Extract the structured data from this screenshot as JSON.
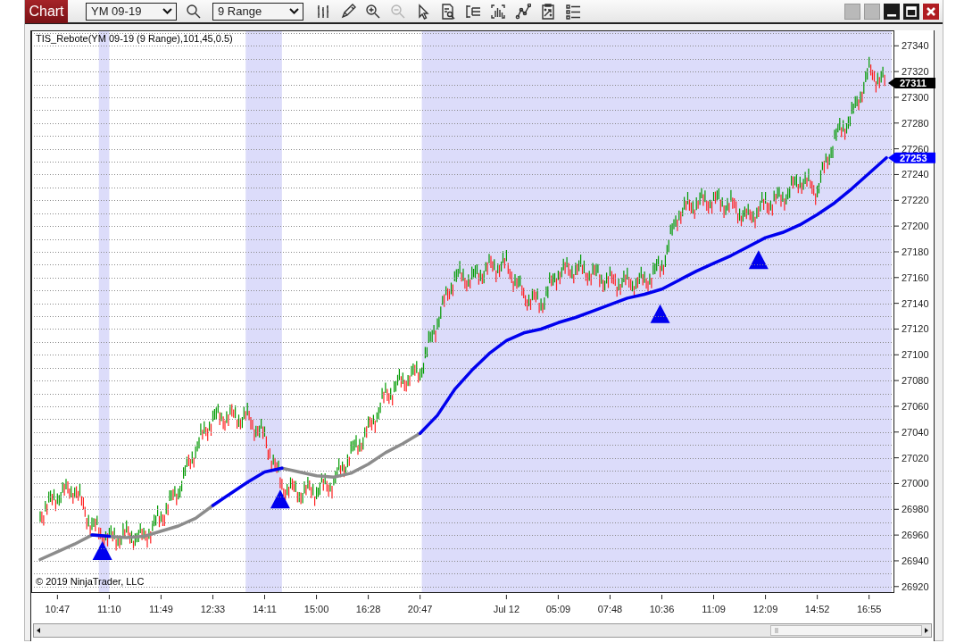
{
  "window": {
    "tab": "Chart",
    "buttons": [
      {
        "kind": "blank"
      },
      {
        "kind": "blank"
      },
      {
        "kind": "minimize"
      },
      {
        "kind": "maximize"
      },
      {
        "kind": "close"
      }
    ]
  },
  "toolbar": {
    "items": [
      {
        "kind": "dropdown",
        "value": "YM 09-19"
      },
      {
        "kind": "search",
        "disabled": false
      },
      {
        "kind": "dropdown",
        "value": "9 Range"
      },
      {
        "kind": "chart-style",
        "disabled": false
      },
      {
        "kind": "pencil",
        "disabled": false
      },
      {
        "kind": "zoom-in",
        "disabled": false
      },
      {
        "kind": "zoom-out",
        "disabled": true
      },
      {
        "kind": "pointer",
        "disabled": false
      },
      {
        "kind": "data-box",
        "disabled": false
      },
      {
        "kind": "bar-spacing",
        "disabled": false
      },
      {
        "kind": "bar-chart",
        "disabled": false
      },
      {
        "kind": "line-tool",
        "disabled": false
      },
      {
        "kind": "strategy",
        "disabled": false
      },
      {
        "kind": "list",
        "disabled": false
      }
    ]
  },
  "chart": {
    "indicator_label": "TIS_Rebote(YM 09-19 (9 Range),101,45,0.5)",
    "copyright": "© 2019 NinjaTrader, LLC",
    "price_markers": [
      {
        "kind": "last-price",
        "text": "27311",
        "color": "#000000"
      },
      {
        "kind": "indicator",
        "text": "27253",
        "color": "#0000ff"
      }
    ],
    "chart_data": {
      "type": "line",
      "categories": [
        null,
        "10:47",
        null,
        null,
        "11:10",
        null,
        null,
        "11:49",
        null,
        null,
        "12:33",
        null,
        null,
        "14:11",
        null,
        null,
        "15:00",
        null,
        null,
        "16:28",
        null,
        null,
        "20:47",
        null,
        null,
        null,
        null,
        "Jul 12",
        null,
        null,
        "05:09",
        null,
        null,
        "07:48",
        null,
        null,
        "10:36",
        null,
        null,
        "11:09",
        null,
        null,
        "12:09",
        null,
        null,
        "14:52",
        null,
        null,
        "16:55",
        null
      ],
      "series": [
        {
          "color": "#8c8c8c",
          "values": [
            26941,
            26947,
            26953,
            26960,
            26959,
            26958,
            26959,
            26963,
            26967,
            26973,
            26983,
            null,
            null,
            null,
            27012,
            27009,
            27006,
            27005,
            27008,
            27015,
            27024,
            27031,
            27039,
            null,
            null,
            null,
            null,
            null,
            null,
            null,
            null,
            null,
            null,
            null,
            null,
            null,
            null,
            null,
            null,
            null,
            null,
            null,
            null,
            null,
            null,
            null,
            null,
            null,
            null,
            null
          ]
        },
        {
          "color": "#0000ee",
          "values": [
            null,
            null,
            null,
            26960,
            26959,
            null,
            null,
            null,
            null,
            null,
            26983,
            26992,
            27001,
            27009,
            27012,
            null,
            null,
            null,
            null,
            null,
            null,
            null,
            27039,
            27053,
            27073,
            27088,
            27101,
            27111,
            27117,
            27120,
            27125,
            27129,
            27134,
            27139,
            27144,
            27147,
            27151,
            27158,
            27165,
            27171,
            27177,
            27184,
            27191,
            27195,
            27201,
            27209,
            27218,
            27229,
            27241,
            27253
          ]
        }
      ],
      "ylim": [
        26915,
        27352
      ],
      "yticks": [
        26920,
        26940,
        26960,
        26980,
        27000,
        27020,
        27040,
        27060,
        27080,
        27100,
        27120,
        27140,
        27160,
        27180,
        27200,
        27220,
        27240,
        27260,
        27280,
        27300,
        27320,
        27340
      ],
      "grid": true
    }
  }
}
